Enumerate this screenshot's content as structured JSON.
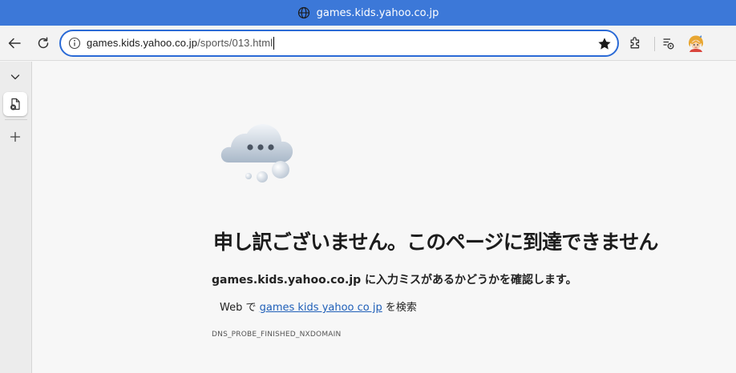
{
  "window": {
    "title": "games.kids.yahoo.co.jp",
    "title_icon": "globe-icon",
    "accent_color": "#3c78d8"
  },
  "toolbar": {
    "back_icon": "back-arrow-icon",
    "reload_icon": "reload-icon",
    "address": {
      "domain": "games.kids.yahoo.co.jp",
      "path": "/sports/013.html",
      "info_icon": "info-icon",
      "favorite_icon": "star-icon"
    },
    "extensions_icon": "puzzle-icon",
    "media_icon": "media-control-icon",
    "profile_icon": "avatar"
  },
  "sidebar": {
    "collapse_icon": "chevron-down-icon",
    "tab_icon": "error-page-tab-icon",
    "new_tab_icon": "plus-icon"
  },
  "error_page": {
    "illustration": "cloud-icon",
    "headline": "申し訳ございません。このページに到達できません",
    "detail_domain": "games.kids.yahoo.co.jp",
    "detail_text": " に入力ミスがあるかどうかを確認します。",
    "search_prefix": "Web で ",
    "search_link": "games kids yahoo co jp",
    "search_suffix": " を検索",
    "error_code": "DNS_PROBE_FINISHED_NXDOMAIN"
  }
}
